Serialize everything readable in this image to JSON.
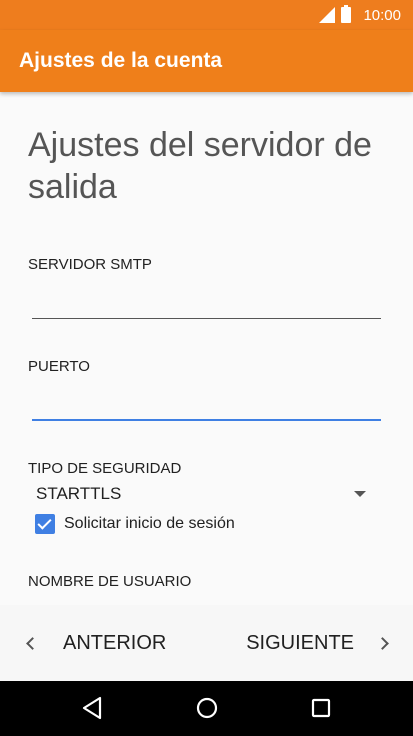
{
  "status_bar": {
    "time": "10:00"
  },
  "app_bar": {
    "title": "Ajustes de la cuenta"
  },
  "page": {
    "title": "Ajustes del servidor de salida",
    "fields": {
      "smtp_label": "SERVIDOR SMTP",
      "smtp_value": "",
      "port_label": "PUERTO",
      "port_value": "",
      "security_label": "TIPO DE SEGURIDAD",
      "security_value": "STARTTLS",
      "require_login_label": "Solicitar inicio de sesión",
      "username_label": "NOMBRE DE USUARIO"
    }
  },
  "footer": {
    "prev_label": "ANTERIOR",
    "next_label": "SIGUIENTE"
  },
  "colors": {
    "app_bar": "#ef7f1a",
    "accent": "#3f7fe3"
  },
  "icons": {
    "signal": "signal-icon",
    "battery": "battery-icon",
    "dropdown": "dropdown-arrow-icon",
    "checkbox": "checkbox-checked-icon",
    "prev": "chevron-left-icon",
    "next": "chevron-right-icon",
    "back": "back-triangle-icon",
    "home": "home-circle-icon",
    "recents": "recents-square-icon"
  }
}
